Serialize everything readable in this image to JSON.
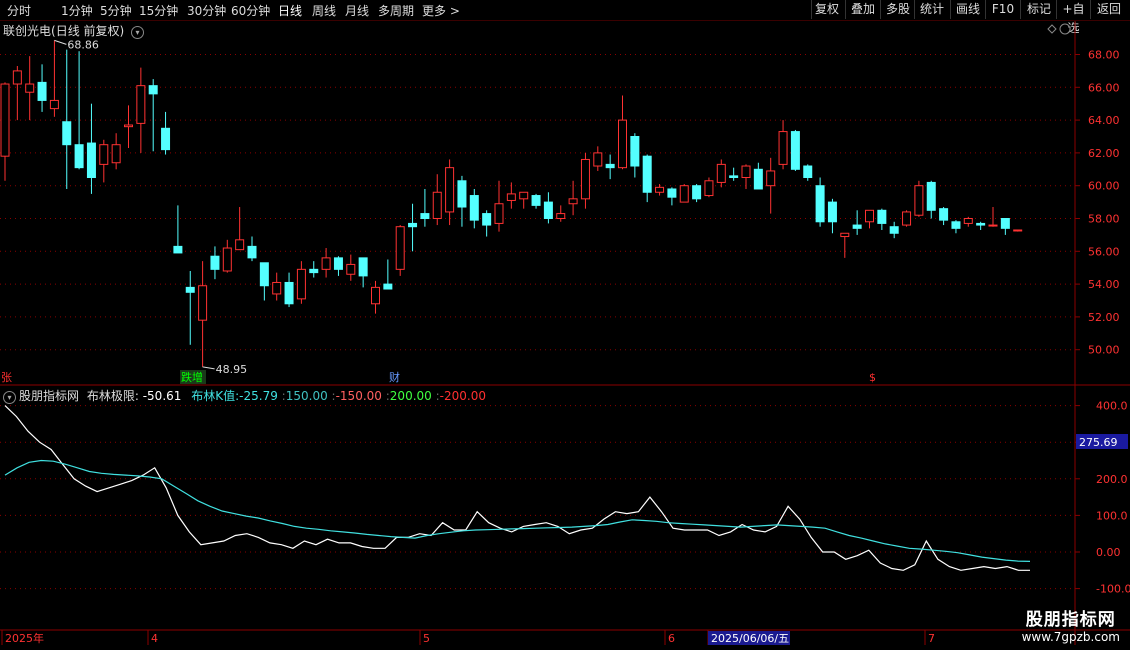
{
  "toolbar": {
    "left": [
      "分时",
      "1分钟",
      "5分钟",
      "15分钟",
      "30分钟",
      "60分钟",
      "日线",
      "周线",
      "月线",
      "多周期",
      "更多 >"
    ],
    "active": "日线",
    "right": [
      "复权",
      "叠加",
      "多股",
      "统计",
      "画线",
      "F10",
      "+自选",
      "返回"
    ],
    "right_extra": "标记"
  },
  "main_title": {
    "name": "联创光电",
    "period": "(日线 前复权)"
  },
  "main_chart": {
    "y_ticks": [
      "68.00",
      "66.00",
      "64.00",
      "62.00",
      "60.00",
      "58.00",
      "56.00",
      "54.00",
      "52.00",
      "50.00"
    ],
    "high_label": "68.86",
    "low_label": "48.95",
    "event_labels": [
      "张",
      "跌增",
      "财",
      "$"
    ]
  },
  "indicator": {
    "source": "股朋指标网",
    "name": "布林极限",
    "value": "-50.61",
    "k_label": "布林K值",
    "k_value": "-25.79",
    "levels": [
      "150.00",
      "-150.00",
      "200.00",
      "-200.00"
    ],
    "y_ticks": [
      "400.0",
      "300.0",
      "200.0",
      "100.0",
      "0.00",
      "-100.0"
    ],
    "current_value": "275.69"
  },
  "x_axis": {
    "labels": [
      "2025年",
      "4",
      "5",
      "6",
      "2025/06/06/五",
      "7"
    ]
  },
  "watermark": {
    "line1": "股朋指标网",
    "line2": "www.7gpzb.com"
  },
  "colors": {
    "up": "#ff3232",
    "down": "#54ffff",
    "grid": "#8b0000",
    "line1": "#ffffff",
    "line2": "#40e0e0"
  },
  "chart_data": {
    "type": "candlestick",
    "candles": [
      {
        "o": 61.8,
        "h": 66.3,
        "l": 60.3,
        "c": 66.2
      },
      {
        "o": 66.2,
        "h": 67.3,
        "l": 64.0,
        "c": 67.0
      },
      {
        "o": 65.7,
        "h": 67.9,
        "l": 64.0,
        "c": 66.2
      },
      {
        "o": 66.3,
        "h": 67.4,
        "l": 64.5,
        "c": 65.2
      },
      {
        "o": 64.7,
        "h": 68.86,
        "l": 64.2,
        "c": 65.2
      },
      {
        "o": 63.9,
        "h": 68.3,
        "l": 59.8,
        "c": 62.5
      },
      {
        "o": 62.5,
        "h": 68.2,
        "l": 61.0,
        "c": 61.1
      },
      {
        "o": 62.6,
        "h": 65.0,
        "l": 59.5,
        "c": 60.5
      },
      {
        "o": 61.3,
        "h": 62.8,
        "l": 60.2,
        "c": 62.5
      },
      {
        "o": 61.4,
        "h": 63.2,
        "l": 61.0,
        "c": 62.5
      },
      {
        "o": 63.6,
        "h": 64.9,
        "l": 62.3,
        "c": 63.7
      },
      {
        "o": 63.8,
        "h": 67.2,
        "l": 62.0,
        "c": 66.1
      },
      {
        "o": 66.1,
        "h": 66.5,
        "l": 62.1,
        "c": 65.6
      },
      {
        "o": 63.5,
        "h": 64.5,
        "l": 61.9,
        "c": 62.2
      },
      {
        "o": 56.3,
        "h": 58.8,
        "l": 55.9,
        "c": 55.9
      },
      {
        "o": 53.8,
        "h": 54.8,
        "l": 50.3,
        "c": 53.5
      },
      {
        "o": 51.8,
        "h": 55.4,
        "l": 48.95,
        "c": 53.9
      },
      {
        "o": 55.7,
        "h": 56.3,
        "l": 54.3,
        "c": 54.9
      },
      {
        "o": 54.8,
        "h": 56.7,
        "l": 54.7,
        "c": 56.2
      },
      {
        "o": 56.1,
        "h": 58.7,
        "l": 56.1,
        "c": 56.7
      },
      {
        "o": 56.3,
        "h": 56.9,
        "l": 55.4,
        "c": 55.6
      },
      {
        "o": 55.3,
        "h": 55.3,
        "l": 53.0,
        "c": 53.9
      },
      {
        "o": 53.4,
        "h": 54.7,
        "l": 53.0,
        "c": 54.1
      },
      {
        "o": 54.1,
        "h": 54.7,
        "l": 52.6,
        "c": 52.8
      },
      {
        "o": 53.1,
        "h": 55.4,
        "l": 52.8,
        "c": 54.9
      },
      {
        "o": 54.9,
        "h": 55.4,
        "l": 54.4,
        "c": 54.7
      },
      {
        "o": 54.9,
        "h": 56.2,
        "l": 54.4,
        "c": 55.6
      },
      {
        "o": 55.6,
        "h": 55.7,
        "l": 54.5,
        "c": 54.9
      },
      {
        "o": 54.6,
        "h": 55.8,
        "l": 54.2,
        "c": 55.2
      },
      {
        "o": 55.6,
        "h": 55.6,
        "l": 53.8,
        "c": 54.5
      },
      {
        "o": 52.8,
        "h": 54.2,
        "l": 52.2,
        "c": 53.8
      },
      {
        "o": 54.0,
        "h": 55.5,
        "l": 53.8,
        "c": 53.7
      },
      {
        "o": 54.9,
        "h": 57.6,
        "l": 54.5,
        "c": 57.5
      },
      {
        "o": 57.7,
        "h": 58.9,
        "l": 56.0,
        "c": 57.5
      },
      {
        "o": 58.3,
        "h": 59.8,
        "l": 57.5,
        "c": 58.0
      },
      {
        "o": 58.0,
        "h": 60.7,
        "l": 57.6,
        "c": 59.6
      },
      {
        "o": 58.4,
        "h": 61.6,
        "l": 57.6,
        "c": 61.1
      },
      {
        "o": 60.3,
        "h": 60.6,
        "l": 57.5,
        "c": 58.7
      },
      {
        "o": 59.4,
        "h": 59.8,
        "l": 57.4,
        "c": 57.9
      },
      {
        "o": 58.3,
        "h": 58.5,
        "l": 56.9,
        "c": 57.6
      },
      {
        "o": 57.7,
        "h": 60.3,
        "l": 57.2,
        "c": 58.9
      },
      {
        "o": 59.1,
        "h": 60.2,
        "l": 58.6,
        "c": 59.5
      },
      {
        "o": 59.2,
        "h": 59.6,
        "l": 58.6,
        "c": 59.6
      },
      {
        "o": 59.4,
        "h": 59.5,
        "l": 58.6,
        "c": 58.8
      },
      {
        "o": 59.0,
        "h": 59.6,
        "l": 57.7,
        "c": 58.0
      },
      {
        "o": 58.0,
        "h": 58.8,
        "l": 57.8,
        "c": 58.3
      },
      {
        "o": 58.9,
        "h": 60.3,
        "l": 58.2,
        "c": 59.2
      },
      {
        "o": 59.2,
        "h": 62.0,
        "l": 58.6,
        "c": 61.6
      },
      {
        "o": 61.2,
        "h": 62.4,
        "l": 60.9,
        "c": 62.0
      },
      {
        "o": 61.3,
        "h": 61.9,
        "l": 60.4,
        "c": 61.1
      },
      {
        "o": 61.1,
        "h": 65.5,
        "l": 61.0,
        "c": 64.0
      },
      {
        "o": 63.0,
        "h": 63.2,
        "l": 60.5,
        "c": 61.2
      },
      {
        "o": 61.8,
        "h": 61.9,
        "l": 59.0,
        "c": 59.6
      },
      {
        "o": 59.6,
        "h": 60.1,
        "l": 59.4,
        "c": 59.9
      },
      {
        "o": 59.8,
        "h": 59.9,
        "l": 58.8,
        "c": 59.3
      },
      {
        "o": 59.0,
        "h": 60.1,
        "l": 59.0,
        "c": 60.0
      },
      {
        "o": 60.0,
        "h": 60.1,
        "l": 59.0,
        "c": 59.2
      },
      {
        "o": 59.4,
        "h": 60.5,
        "l": 59.3,
        "c": 60.3
      },
      {
        "o": 60.2,
        "h": 61.6,
        "l": 59.9,
        "c": 61.3
      },
      {
        "o": 60.6,
        "h": 61.1,
        "l": 60.3,
        "c": 60.5
      },
      {
        "o": 60.5,
        "h": 61.3,
        "l": 59.8,
        "c": 61.2
      },
      {
        "o": 61.0,
        "h": 61.4,
        "l": 60.6,
        "c": 59.8
      },
      {
        "o": 60.0,
        "h": 61.7,
        "l": 58.3,
        "c": 60.9
      },
      {
        "o": 61.3,
        "h": 64.0,
        "l": 61.0,
        "c": 63.3
      },
      {
        "o": 63.3,
        "h": 63.4,
        "l": 60.9,
        "c": 61.0
      },
      {
        "o": 61.2,
        "h": 61.3,
        "l": 60.3,
        "c": 60.5
      },
      {
        "o": 60.0,
        "h": 60.5,
        "l": 57.5,
        "c": 57.8
      },
      {
        "o": 59.0,
        "h": 59.2,
        "l": 57.1,
        "c": 57.8
      },
      {
        "o": 56.9,
        "h": 56.9,
        "l": 55.6,
        "c": 57.1
      },
      {
        "o": 57.6,
        "h": 58.5,
        "l": 57.0,
        "c": 57.4
      },
      {
        "o": 57.8,
        "h": 58.5,
        "l": 57.4,
        "c": 58.5
      },
      {
        "o": 58.5,
        "h": 58.6,
        "l": 57.3,
        "c": 57.7
      },
      {
        "o": 57.5,
        "h": 57.8,
        "l": 56.8,
        "c": 57.1
      },
      {
        "o": 57.6,
        "h": 58.5,
        "l": 57.5,
        "c": 58.4
      },
      {
        "o": 58.2,
        "h": 60.3,
        "l": 58.1,
        "c": 60.0
      },
      {
        "o": 60.2,
        "h": 60.3,
        "l": 58.0,
        "c": 58.5
      },
      {
        "o": 58.6,
        "h": 58.7,
        "l": 57.6,
        "c": 57.9
      },
      {
        "o": 57.8,
        "h": 57.9,
        "l": 57.1,
        "c": 57.4
      },
      {
        "o": 57.7,
        "h": 58.1,
        "l": 57.5,
        "c": 58.0
      },
      {
        "o": 57.7,
        "h": 57.8,
        "l": 57.3,
        "c": 57.6
      },
      {
        "o": 57.6,
        "h": 58.7,
        "l": 57.5,
        "c": 57.6
      },
      {
        "o": 58.0,
        "h": 58.0,
        "l": 57.0,
        "c": 57.4
      },
      {
        "o": 57.3,
        "h": 57.3,
        "l": 57.2,
        "c": 57.3
      }
    ],
    "indicator_series": [
      {
        "name": "布林极限",
        "color": "#ffffff",
        "values": [
          400,
          370,
          330,
          300,
          280,
          240,
          200,
          180,
          165,
          175,
          185,
          195,
          210,
          230,
          175,
          100,
          55,
          20,
          25,
          30,
          45,
          50,
          40,
          25,
          20,
          10,
          30,
          20,
          35,
          25,
          25,
          15,
          10,
          10,
          40,
          40,
          50,
          45,
          80,
          60,
          60,
          110,
          80,
          65,
          55,
          70,
          75,
          80,
          70,
          50,
          60,
          65,
          90,
          110,
          105,
          110,
          150,
          110,
          65,
          60,
          60,
          60,
          45,
          55,
          75,
          60,
          55,
          70,
          125,
          90,
          40,
          0,
          0,
          -20,
          -10,
          5,
          -30,
          -45,
          -50,
          -35,
          30,
          -20,
          -40,
          -50,
          -45,
          -40,
          -45,
          -40,
          -50,
          -50
        ]
      },
      {
        "name": "布林K值",
        "color": "#40e0e0",
        "values": [
          210,
          230,
          245,
          250,
          248,
          240,
          230,
          220,
          215,
          212,
          210,
          208,
          205,
          200,
          180,
          160,
          140,
          125,
          112,
          105,
          98,
          93,
          85,
          78,
          70,
          65,
          62,
          58,
          55,
          52,
          48,
          45,
          42,
          40,
          38,
          45,
          50,
          54,
          58,
          60,
          61,
          62,
          63,
          64,
          65,
          66,
          67,
          68,
          70,
          72,
          75,
          82,
          88,
          86,
          84,
          80,
          78,
          76,
          74,
          72,
          70,
          68,
          70,
          72,
          74,
          72,
          70,
          68,
          65,
          55,
          45,
          38,
          30,
          22,
          16,
          10,
          8,
          5,
          2,
          -2,
          -8,
          -14,
          -18,
          -22,
          -25,
          -25.79
        ]
      }
    ]
  }
}
